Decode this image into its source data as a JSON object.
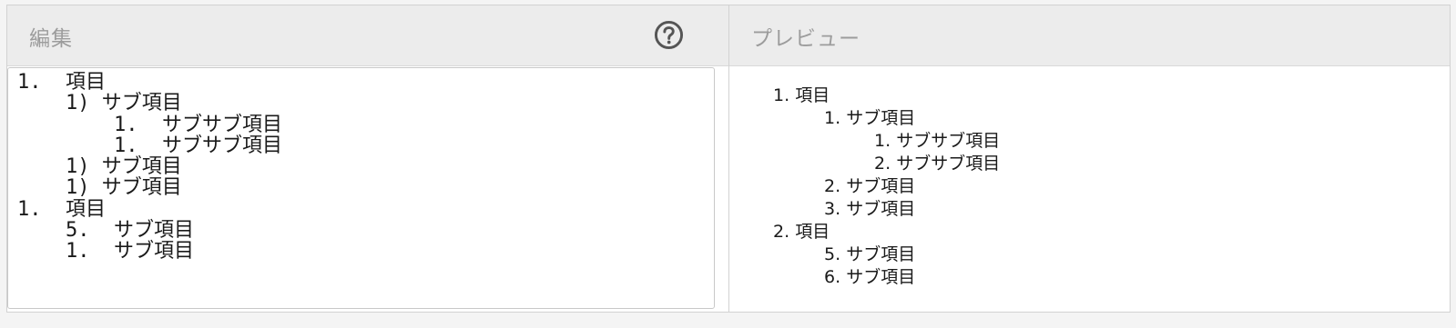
{
  "editor": {
    "title": "編集",
    "help_icon": "question-circle-icon",
    "lines": [
      "1.  項目",
      "    1) サブ項目",
      "        1.  サブサブ項目",
      "        1.  サブサブ項目",
      "    1) サブ項目",
      "    1) サブ項目",
      "1.  項目",
      "    5.  サブ項目",
      "    1.  サブ項目"
    ]
  },
  "preview": {
    "title": "プレビュー",
    "items": [
      {
        "num": "1.",
        "text": "項目",
        "level": 0
      },
      {
        "num": "1.",
        "text": "サブ項目",
        "level": 1
      },
      {
        "num": "1.",
        "text": "サブサブ項目",
        "level": 2
      },
      {
        "num": "2.",
        "text": "サブサブ項目",
        "level": 2
      },
      {
        "num": "2.",
        "text": "サブ項目",
        "level": 1
      },
      {
        "num": "3.",
        "text": "サブ項目",
        "level": 1
      },
      {
        "num": "2.",
        "text": "項目",
        "level": 0
      },
      {
        "num": "5.",
        "text": "サブ項目",
        "level": 1
      },
      {
        "num": "6.",
        "text": "サブ項目",
        "level": 1
      }
    ]
  },
  "colors": {
    "header_bg": "#ececec",
    "title_text": "#9c9c9c",
    "icon": "#555555"
  }
}
